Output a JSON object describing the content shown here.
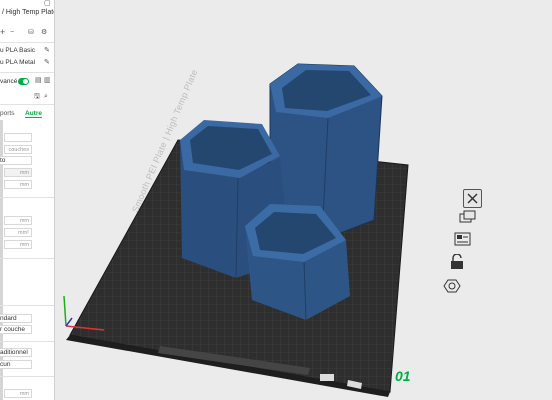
{
  "sidebar": {
    "plate_type": "/ High Temp Plate",
    "filaments": [
      "u PLA Basic",
      "u PLA Metal"
    ],
    "mode_label": "vancé",
    "tabs": {
      "supports": "ports",
      "other": "Autre"
    },
    "layer_unit": "couches",
    "value_auto": "to",
    "unit_mm": "mm",
    "unit_mm2": "mm²",
    "opt_standard": "ndard",
    "opt_per_layer": "r couche",
    "opt_traditional": "aditionnel",
    "opt_none": "cun"
  },
  "plate": {
    "label": "Smooth PEI Plate | High Temp Plate",
    "plate_number": "01"
  },
  "colors": {
    "accent": "#00ae42",
    "model_blue": "#2a4f7e",
    "bed": "#2f2f2f"
  }
}
